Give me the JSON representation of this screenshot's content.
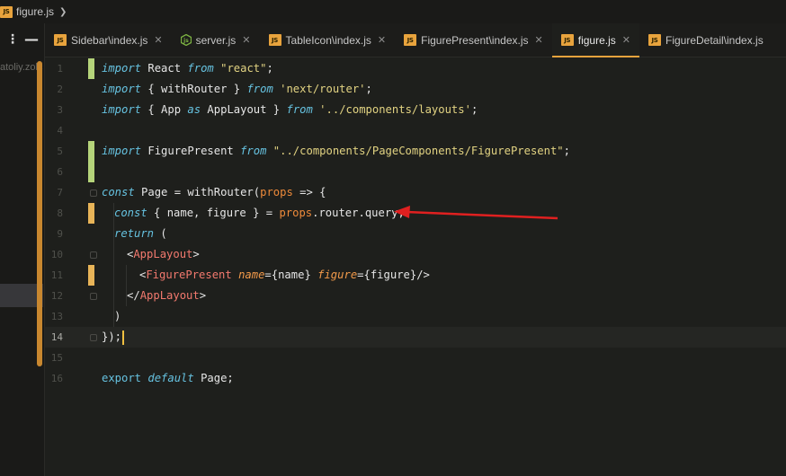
{
  "breadcrumb": {
    "file": "figure.js",
    "badge": "JS"
  },
  "sidebar": {
    "truncated_text": "atoliy.zolc"
  },
  "tabs": [
    {
      "label": "Sidebar\\index.js",
      "icon": "js-icon",
      "badge": "JS",
      "close": "✕",
      "active": false
    },
    {
      "label": "server.js",
      "icon": "nodejs-icon",
      "badge": "",
      "close": "✕",
      "active": false
    },
    {
      "label": "TableIcon\\index.js",
      "icon": "js-icon",
      "badge": "JS",
      "close": "✕",
      "active": false
    },
    {
      "label": "FigurePresent\\index.js",
      "icon": "js-icon",
      "badge": "JS",
      "close": "✕",
      "active": false
    },
    {
      "label": "figure.js",
      "icon": "js-icon",
      "badge": "JS",
      "close": "✕",
      "active": true
    },
    {
      "label": "FigureDetail\\index.js",
      "icon": "js-icon",
      "badge": "JS",
      "close": "",
      "active": false
    }
  ],
  "code": {
    "line_numbers": [
      "1",
      "2",
      "3",
      "4",
      "5",
      "6",
      "7",
      "8",
      "9",
      "10",
      "11",
      "12",
      "13",
      "14",
      "15",
      "16"
    ],
    "current_line": "14",
    "lines": {
      "l1": {
        "a": "import",
        "b": " React ",
        "c": "from",
        "d": " \"react\"",
        "e": ";"
      },
      "l2": {
        "a": "import",
        "b": " { withRouter } ",
        "c": "from",
        "d": " 'next/router'",
        "e": ";"
      },
      "l3": {
        "a": "import",
        "b": " { App ",
        "c": "as",
        "d": " AppLayout } ",
        "e": "from",
        "f": " '../components/layouts'",
        "g": ";"
      },
      "l5": {
        "a": "import",
        "b": " FigurePresent ",
        "c": "from",
        "d": " \"../components/PageComponents/FigurePresent\"",
        "e": ";"
      },
      "l7": {
        "a": "const",
        "b": " Page = withRouter(",
        "c": "props",
        "d": " => {"
      },
      "l8": {
        "a": "const",
        "b": " { name, figure } = ",
        "c": "props",
        "d": ".router.query;"
      },
      "l9": {
        "a": "return",
        "b": " ("
      },
      "l10": {
        "a": "<",
        "b": "AppLayout",
        "c": ">"
      },
      "l11": {
        "a": "<",
        "b": "FigurePresent",
        "c": " name",
        "d": "={name}",
        "e": " figure",
        "f": "={figure}",
        "g": "/>"
      },
      "l12": {
        "a": "</",
        "b": "AppLayout",
        "c": ">"
      },
      "l13": {
        "a": ")"
      },
      "l14": {
        "a": "});"
      },
      "l16": {
        "a": "export",
        "b": " ",
        "c": "default",
        "d": " Page;"
      }
    }
  },
  "colors": {
    "accent": "#e8a33d",
    "arrow": "#e02020",
    "added": "#b5d47a",
    "modified": "#e8b458"
  }
}
